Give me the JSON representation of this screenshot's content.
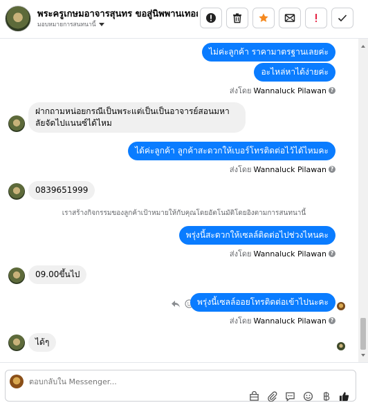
{
  "header": {
    "contact_name": "พระครูเกษมอาจารสุนทร ขอสู่นิพพานเทอญ",
    "assign_label": "มอบหมายการสนทนานี้",
    "toolbar": [
      "info-icon",
      "trash-icon",
      "star-icon",
      "mark-unread-icon",
      "spam-icon",
      "done-icon"
    ]
  },
  "messages": [
    {
      "dir": "out",
      "text": "ไม่ค่ะลูกค้า ราคามาตรฐานเลยค่ะ"
    },
    {
      "dir": "out",
      "text": "อะไหล่หาได้ง่ายค่ะ"
    },
    {
      "sent_by_prefix": "ส่งโดย",
      "sent_by_name": "Wannaluck Pilawan"
    },
    {
      "dir": "in",
      "text": "ฝากถามหน่อยกรณีเป็นพระแต่เป็นเป็นอาจารย์สอนมหาลัยจัดไปแนนซ์ได้ไหม"
    },
    {
      "dir": "out",
      "text": "ได้ค่ะลูกค้า  ลูกค้าสะดวกให้เบอร์โทรติดต่อไว้ได้ไหมคะ"
    },
    {
      "sent_by_prefix": "ส่งโดย",
      "sent_by_name": "Wannaluck Pilawan"
    },
    {
      "dir": "in",
      "text": "0839651999"
    },
    {
      "system": "เราสร้างกิจกรรมของลูกค้าเป้าหมายให้กับคุณโดยอัตโนมัติโดยอิงตามการสนทนานี้"
    },
    {
      "dir": "out",
      "text": "พรุ่งนี้สะดวกให้เซลล์ติดต่อไปช่วงไหนคะ"
    },
    {
      "sent_by_prefix": "ส่งโดย",
      "sent_by_name": "Wannaluck Pilawan"
    },
    {
      "dir": "in",
      "text": "09.00ขึ้นไป"
    },
    {
      "dir": "out",
      "text": "พรุ่งนี้เซลล์ออยโทรติดต่อเข้าไปนะคะ"
    },
    {
      "sent_by_prefix": "ส่งโดย",
      "sent_by_name": "Wannaluck Pilawan"
    },
    {
      "dir": "in",
      "text": "ได้ๆ"
    }
  ],
  "composer": {
    "placeholder": "ตอบกลับใน Messenger...",
    "tools": [
      "shop-icon",
      "attach-icon",
      "quick-reply-icon",
      "emoji-icon",
      "payment-icon",
      "like-icon"
    ]
  },
  "colors": {
    "outgoing_bubble": "#0a7cff",
    "incoming_bubble": "#f0f0f0",
    "star_accent": "#f5891f",
    "spam_accent": "#e41e3f"
  }
}
